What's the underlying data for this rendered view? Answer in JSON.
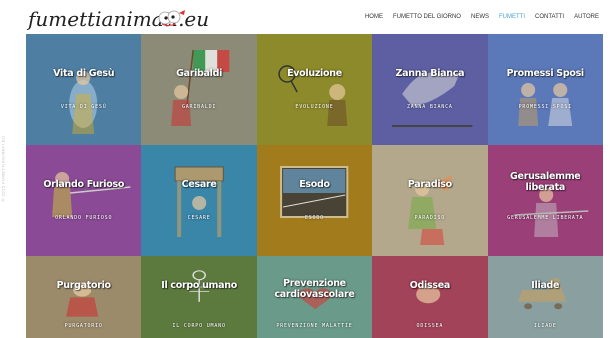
{
  "header": {
    "logo_text": "fumettianimati.eu",
    "nav": [
      {
        "label": "HOME",
        "active": false
      },
      {
        "label": "FUMETTO DEL GIORNO",
        "active": false
      },
      {
        "label": "NEWS",
        "active": false
      },
      {
        "label": "FUMETTI",
        "active": true
      },
      {
        "label": "CONTATTI",
        "active": false
      },
      {
        "label": "AUTORE",
        "active": false
      }
    ]
  },
  "sidebar": {
    "credit": "© 2015 FUMETTIANIMATI.EU"
  },
  "tiles": [
    {
      "title": "Vita di Gesù",
      "subtitle": "VITA DI GESÙ",
      "color": "#4e7fa3",
      "icon": "jesus-figure-icon"
    },
    {
      "title": "Garibaldi",
      "subtitle": "GARIBALDI",
      "color": "#8c8b77",
      "icon": "garibaldi-flag-icon"
    },
    {
      "title": "Evoluzione",
      "subtitle": "EVOLUZIONE",
      "color": "#8c8a2a",
      "icon": "caveman-icon"
    },
    {
      "title": "Zanna Bianca",
      "subtitle": "ZANNA BIANCA",
      "color": "#5d5fa2",
      "icon": "wolf-icon"
    },
    {
      "title": "Promessi Sposi",
      "subtitle": "PROMESSI SPOSI",
      "color": "#5b78b8",
      "icon": "couple-icon"
    },
    {
      "title": "Orlando Furioso",
      "subtitle": "ORLANDO FURIOSO",
      "color": "#8a4a95",
      "icon": "knight-icon"
    },
    {
      "title": "Cesare",
      "subtitle": "CESARE",
      "color": "#3a86a8",
      "icon": "caesar-sign-icon"
    },
    {
      "title": "Esodo",
      "subtitle": "ESODO",
      "color": "#a17b1c",
      "icon": "exodus-icon"
    },
    {
      "title": "Paradiso",
      "subtitle": "PARADISO",
      "color": "#b3a88b",
      "icon": "angels-icon"
    },
    {
      "title": "Gerusalemme liberata",
      "subtitle": "GERUSALEMME LIBERATA",
      "color": "#9a3f78",
      "icon": "crusader-icon"
    },
    {
      "title": "Purgatorio",
      "subtitle": "PURGATORIO",
      "color": "#9b8b6b",
      "icon": "dante-icon"
    },
    {
      "title": "Il corpo umano",
      "subtitle": "IL CORPO UMANO",
      "color": "#5d7a3e",
      "icon": "skeleton-icon"
    },
    {
      "title": "Prevenzione cardiovascolare",
      "subtitle": "PREVENZIONE MALATTIE",
      "color": "#6a9a8a",
      "icon": "heart-icon"
    },
    {
      "title": "Odissea",
      "subtitle": "ODISSEA",
      "color": "#a3435a",
      "icon": "ulysses-icon"
    },
    {
      "title": "Iliade",
      "subtitle": "ILIADE",
      "color": "#8aa0a0",
      "icon": "trojan-horse-icon"
    }
  ]
}
